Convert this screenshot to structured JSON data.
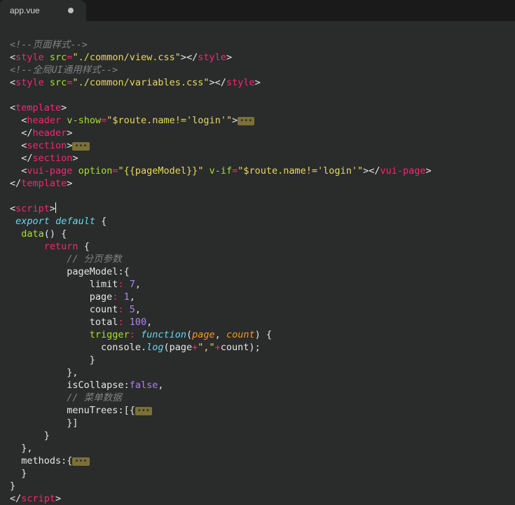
{
  "tab": {
    "filename": "app.vue",
    "modified": true
  },
  "fold_marker": "•••",
  "code": {
    "c1": "<!--页面样式-->",
    "style1_src": "./common/view.css",
    "c2": "<!--全局UI通用样式-->",
    "style2_src": "./common/variables.css",
    "header_vshow": "$route.name!='login'",
    "vui_option": "{{pageModel}}",
    "vui_vif": "$route.name!='login'",
    "comment_page": "// 分页参数",
    "limit": "7",
    "page": "1",
    "count": "5",
    "total": "100",
    "log_comma": "\",\"",
    "comment_menu": "// 菜单数据"
  },
  "tokens": {
    "style": "style",
    "src": "src",
    "template": "template",
    "header": "header",
    "v_show": "v-show",
    "section": "section",
    "vui_page": "vui-page",
    "option": "option",
    "v_if": "v-if",
    "script": "script",
    "export": "export",
    "default": "default",
    "data": "data",
    "return": "return",
    "pageModel": "pageModel",
    "limit": "limit",
    "page": "page",
    "count": "count",
    "total": "total",
    "trigger": "trigger",
    "function": "function",
    "p_page": "page",
    "p_count": "count",
    "console": "console",
    "log": "log",
    "isCollapse": "isCollapse",
    "false": "false",
    "menuTrees": "menuTrees",
    "methods": "methods"
  }
}
